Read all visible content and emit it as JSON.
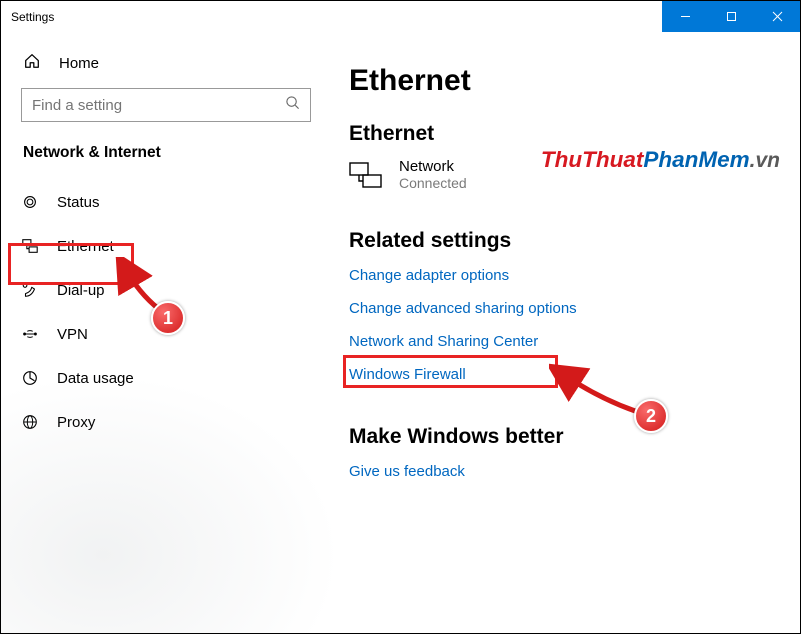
{
  "window": {
    "title": "Settings"
  },
  "sidebar": {
    "home_label": "Home",
    "search_placeholder": "Find a setting",
    "section_title": "Network & Internet",
    "items": [
      {
        "label": "Status"
      },
      {
        "label": "Ethernet"
      },
      {
        "label": "Dial-up"
      },
      {
        "label": "VPN"
      },
      {
        "label": "Data usage"
      },
      {
        "label": "Proxy"
      }
    ]
  },
  "content": {
    "page_title": "Ethernet",
    "subheading": "Ethernet",
    "adapter": {
      "name": "Network",
      "status": "Connected"
    },
    "related_title": "Related settings",
    "links": [
      "Change adapter options",
      "Change advanced sharing options",
      "Network and Sharing Center",
      "Windows Firewall"
    ],
    "feedback_title": "Make Windows better",
    "feedback_link": "Give us feedback"
  },
  "watermark": {
    "part1": "ThuThuat",
    "part2": "PhanMem",
    "part3": ".vn"
  },
  "annotations": {
    "step1": "1",
    "step2": "2"
  }
}
